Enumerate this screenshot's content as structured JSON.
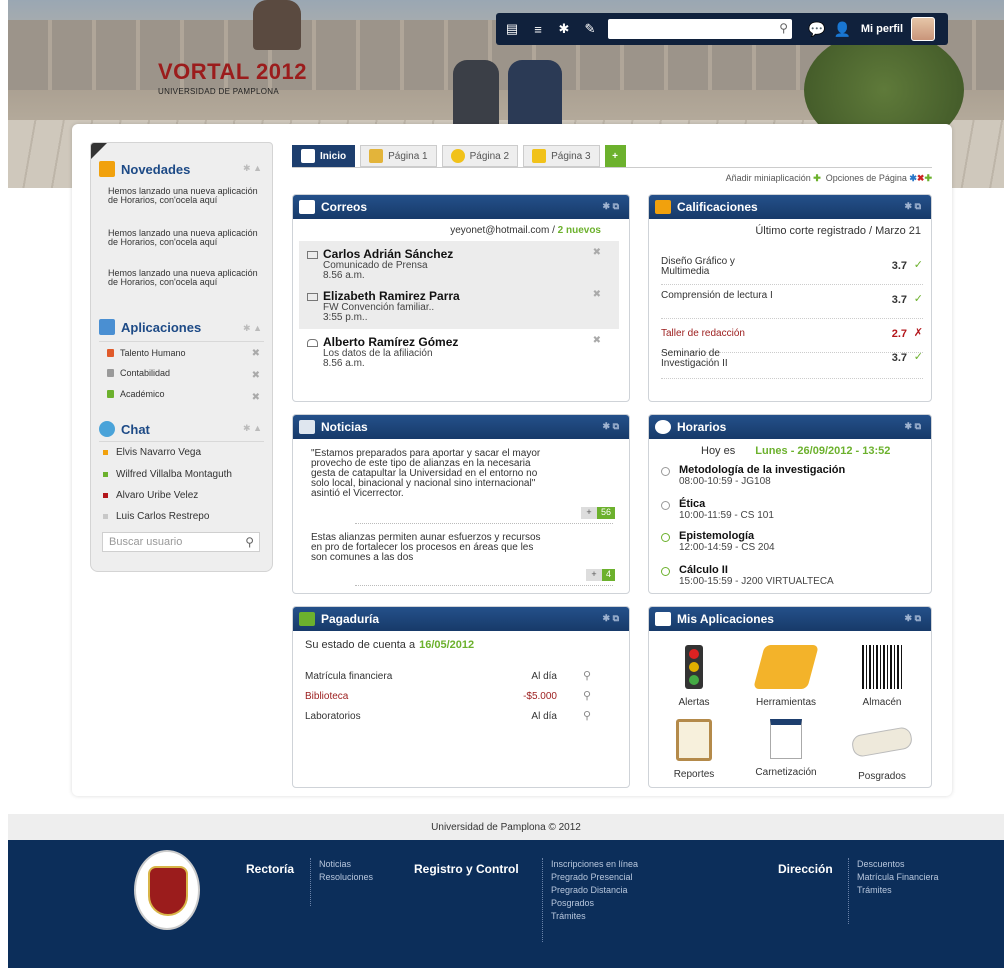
{
  "brand": {
    "title": "VORTAL 2012",
    "subtitle": "UNIVERSIDAD DE PAMPLONA"
  },
  "topbar": {
    "profile_label": "Mi perfil"
  },
  "sidebar": {
    "news_title": "Novedades",
    "news": [
      "Hemos lanzado una nueva aplicación de Horarios, con'ocela aquí",
      "Hemos lanzado una nueva aplicación de Horarios, con'ocela aquí",
      "Hemos lanzado una nueva aplicación de Horarios, con'ocela aquí"
    ],
    "apps_title": "Aplicaciones",
    "apps": [
      "Talento Humano",
      "Contabilidad",
      "Académico"
    ],
    "chat_title": "Chat",
    "chat_users": [
      {
        "name": "Elvis Navarro Vega",
        "status_color": "#f1a10d"
      },
      {
        "name": "Wilfred Villalba Montaguth",
        "status_color": "#6cb12d"
      },
      {
        "name": "Alvaro Uribe Velez",
        "status_color": "#b3161b"
      },
      {
        "name": "Luis Carlos Restrepo",
        "status_color": "#c8c8c8"
      }
    ],
    "search_placeholder": "Buscar usuario"
  },
  "tabs": [
    "Inicio",
    "Página 1",
    "Página 2",
    "Página 3"
  ],
  "tab_add": "+",
  "page_options": {
    "add_widget": "Añadir miniaplicación",
    "options": "Opciones de Página"
  },
  "mail": {
    "title": "Correos",
    "account": "yeyonet@hotmail.com",
    "new_count": "2 nuevos",
    "messages": [
      {
        "from": "Carlos Adrián Sánchez",
        "subject": "Comunicado de Prensa",
        "time": "8.56 a.m."
      },
      {
        "from": "Elizabeth Ramirez Parra",
        "subject": "FW Convención familiar..",
        "time": "3:55 p.m.."
      },
      {
        "from": "Alberto Ramírez Gómez",
        "subject": "Los datos de la afiliación",
        "time": "8.56 a.m."
      }
    ]
  },
  "grades": {
    "title": "Calificaciones",
    "header": "Último corte registrado / Marzo 21",
    "items": [
      {
        "course": "Diseño Gráfico y Multimedia",
        "grade": "3.7",
        "mark": "✓"
      },
      {
        "course": "Comprensión de lectura I",
        "grade": "3.7",
        "mark": "✓"
      },
      {
        "course": "Taller de redacción",
        "grade": "2.7",
        "mark": "✗"
      },
      {
        "course": "Seminario de Investigación II",
        "grade": "3.7",
        "mark": "✓"
      }
    ]
  },
  "news": {
    "title": "Noticias",
    "items": [
      {
        "text": "\"Estamos preparados para aportar y sacar el mayor provecho de este tipo de alianzas en la necesaria gesta de catapultar la Universidad en el entorno no solo local, binacional y nacional sino internacional\" asintió el Vicerrector.",
        "plus": "+",
        "count": "56"
      },
      {
        "text": "Estas alianzas permiten aunar esfuerzos y recursos en pro de fortalecer los procesos en áreas que les son comunes a las dos",
        "plus": "+",
        "count": "4"
      }
    ]
  },
  "schedule": {
    "title": "Horarios",
    "today_label": "Hoy es",
    "today_value": "Lunes - 26/09/2012 - 13:52",
    "items": [
      {
        "course": "Metodología de la investigación",
        "detail": "08:00-10:59 - JG108"
      },
      {
        "course": "Ética",
        "detail": "10:00-11:59 - CS 101"
      },
      {
        "course": "Epistemología",
        "detail": "12:00-14:59 - CS 204"
      },
      {
        "course": "Cálculo II",
        "detail": "15:00-15:59 - J200 VIRTUALTECA"
      }
    ]
  },
  "payments": {
    "title": "Pagaduría",
    "status_label": "Su estado de cuenta a",
    "status_date": "16/05/2012",
    "items": [
      {
        "concept": "Matrícula financiera",
        "value": "Al día"
      },
      {
        "concept": "Biblioteca",
        "value": "-$5.000"
      },
      {
        "concept": "Laboratorios",
        "value": "Al día"
      }
    ]
  },
  "my_apps": {
    "title": "Mis Aplicaciones",
    "items": [
      "Alertas",
      "Herramientas",
      "Almacén",
      "Reportes",
      "Carnetización",
      "Posgrados"
    ]
  },
  "footer": {
    "copyright": "Universidad de Pamplona © 2012",
    "rectoria": {
      "title": "Rectoría",
      "links": [
        "Noticias",
        "Resoluciones"
      ]
    },
    "registro": {
      "title": "Registro y Control",
      "links": [
        "Inscripciones en línea",
        "Pregrado Presencial",
        "Pregrado Distancia",
        "Posgrados",
        "Trámites"
      ]
    },
    "direccion": {
      "title": "Dirección",
      "links": [
        "Descuentos",
        "Matrícula Financiera",
        "Trámites"
      ]
    }
  }
}
